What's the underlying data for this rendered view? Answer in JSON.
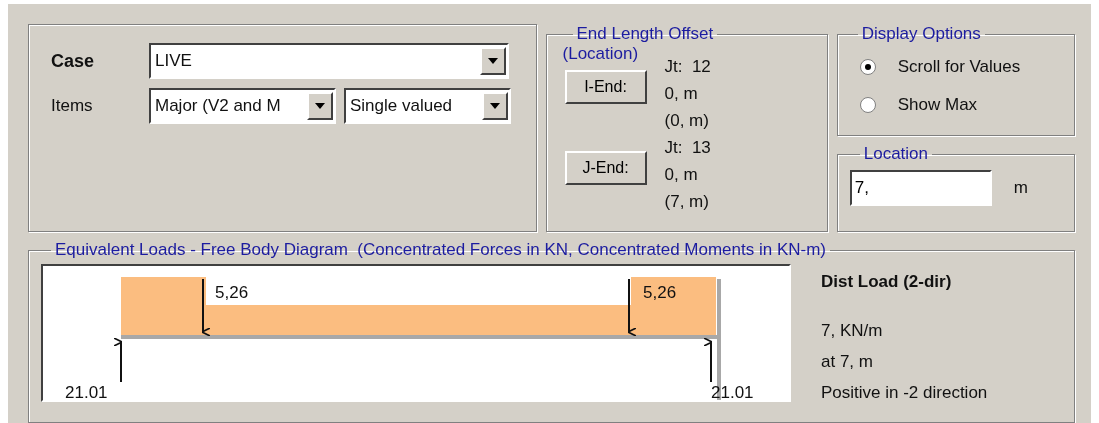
{
  "case_panel": {
    "case": {
      "label": "Case",
      "value": "LIVE"
    },
    "items": {
      "label": "Items",
      "component": "Major (V2 and M",
      "value_type": "Single valued"
    }
  },
  "end_length_offset": {
    "title": "End Length Offset",
    "subtitle": "(Location)",
    "ends": [
      {
        "button": "I-End:",
        "joint": "Jt:  12",
        "offset": "0, m",
        "location": "(0, m)"
      },
      {
        "button": "J-End:",
        "joint": "Jt:  13",
        "offset": "0, m",
        "location": "(7, m)"
      }
    ]
  },
  "display_options": {
    "title": "Display Options",
    "options": [
      {
        "label": "Scroll for Values",
        "selected": true
      },
      {
        "label": "Show Max",
        "selected": false
      }
    ]
  },
  "location": {
    "title": "Location",
    "value": "7,",
    "unit": "m"
  },
  "free_body_diagram": {
    "title": "Equivalent Loads - Free Body Diagram  (Concentrated Forces in KN, Concentrated Moments in KN-m)",
    "point_loads": [
      "5,26",
      "5,26"
    ],
    "reactions": [
      "21.01",
      "21.01"
    ],
    "info": {
      "heading": "Dist Load (2-dir)",
      "magnitude": "7, KN/m",
      "position": "at 7, m",
      "direction": "Positive in -2 direction"
    }
  }
}
